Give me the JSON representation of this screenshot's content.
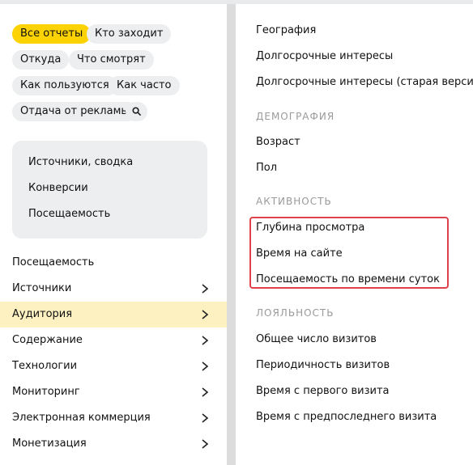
{
  "chips": {
    "all_reports": "Все отчеты",
    "who_visits": "Кто заходит",
    "from_where": "Откуда",
    "what_they_watch": "Что смотрят",
    "how_they_use": "Как пользуются",
    "how_often": "Как часто",
    "ad_return": "Отдача от рекламы",
    "search_icon": "search-icon"
  },
  "summary": {
    "items": [
      "Источники, сводка",
      "Конверсии",
      "Посещаемость"
    ]
  },
  "nav": {
    "items": [
      {
        "label": "Посещаемость",
        "has_chevron": false
      },
      {
        "label": "Источники",
        "has_chevron": true
      },
      {
        "label": "Аудитория",
        "has_chevron": true,
        "active": true
      },
      {
        "label": "Содержание",
        "has_chevron": true
      },
      {
        "label": "Технологии",
        "has_chevron": true
      },
      {
        "label": "Мониторинг",
        "has_chevron": true
      },
      {
        "label": "Электронная коммерция",
        "has_chevron": true
      },
      {
        "label": "Монетизация",
        "has_chevron": true
      }
    ],
    "active_color": "#fdf1c2"
  },
  "reports": {
    "top": [
      "География",
      "Долгосрочные интересы",
      "Долгосрочные интересы (старая версия)"
    ],
    "demography_heading": "ДЕМОГРАФИЯ",
    "demography": [
      "Возраст",
      "Пол"
    ],
    "activity_heading": "АКТИВНОСТЬ",
    "activity": [
      "Глубина просмотра",
      "Время на сайте",
      "Посещаемость по времени суток"
    ],
    "loyalty_heading": "ЛОЯЛЬНОСТЬ",
    "loyalty": [
      "Общее число визитов",
      "Периодичность визитов",
      "Время с первого визита",
      "Время с предпоследнего визита"
    ]
  },
  "colors": {
    "accent": "#fcd200",
    "highlight_border": "#e0404a"
  }
}
